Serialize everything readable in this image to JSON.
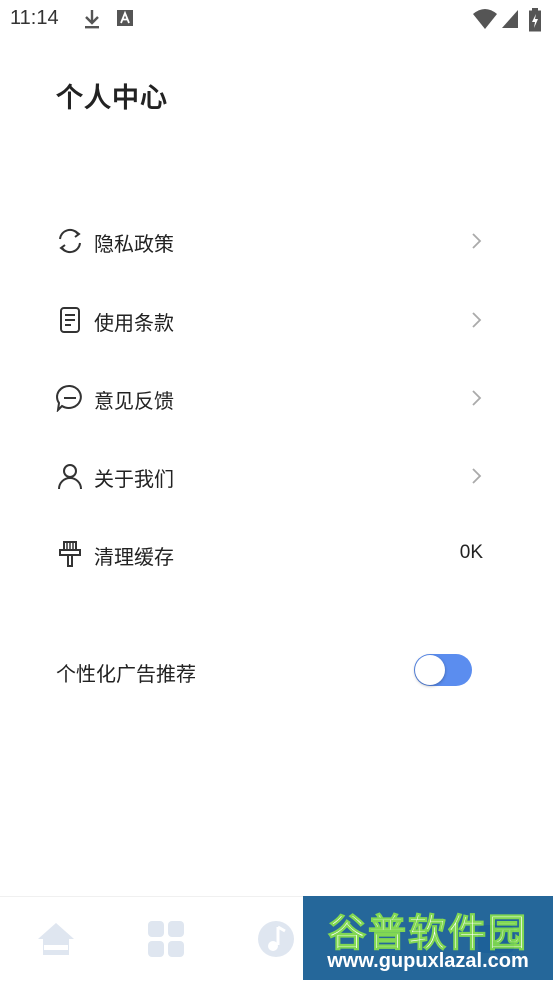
{
  "status_bar": {
    "time": "11:14",
    "icons": [
      "download-icon",
      "keyboard-a-icon",
      "wifi-icon",
      "signal-icon",
      "battery-charging-icon"
    ]
  },
  "page": {
    "title": "个人中心"
  },
  "menu": {
    "items": [
      {
        "label": "隐私政策",
        "icon": "refresh-icon",
        "value": ""
      },
      {
        "label": "使用条款",
        "icon": "document-icon",
        "value": ""
      },
      {
        "label": "意见反馈",
        "icon": "chat-bubble-icon",
        "value": ""
      },
      {
        "label": "关于我们",
        "icon": "person-icon",
        "value": ""
      },
      {
        "label": "清理缓存",
        "icon": "broom-icon",
        "value": "0K"
      }
    ]
  },
  "personalized_ads": {
    "label": "个性化广告推荐",
    "enabled": true,
    "accent_color": "#5b8def"
  },
  "bottom_nav": {
    "items": [
      "home-icon",
      "grid-icon",
      "music-icon",
      "profile-icon"
    ]
  },
  "watermark": {
    "title": "谷普软件园",
    "url": "www.gupuxlazal.com"
  }
}
